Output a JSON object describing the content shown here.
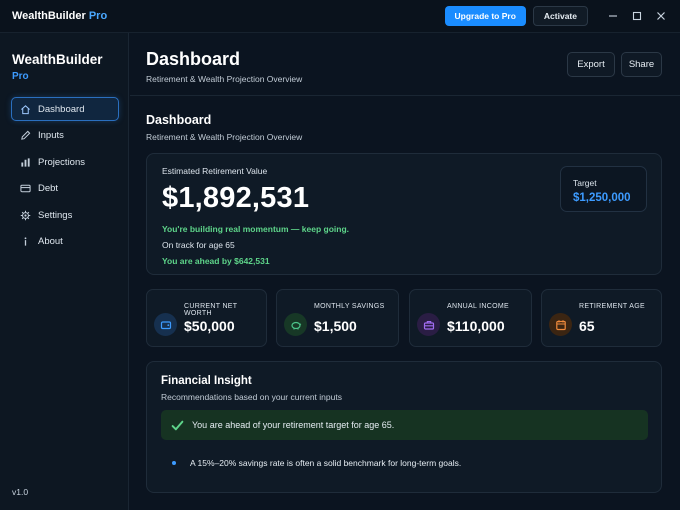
{
  "window": {
    "app_name": "WealthBuilder",
    "app_edition": "Pro",
    "upgrade_label": "Upgrade to Pro",
    "activate_label": "Activate"
  },
  "sidebar": {
    "brand": "WealthBuilder",
    "brand_sub": "Pro",
    "items": [
      {
        "label": "Dashboard",
        "icon": "home-icon",
        "active": true
      },
      {
        "label": "Inputs",
        "icon": "pencil-icon"
      },
      {
        "label": "Projections",
        "icon": "bar-chart-icon"
      },
      {
        "label": "Debt",
        "icon": "credit-card-icon"
      },
      {
        "label": "Settings",
        "icon": "gear-icon"
      },
      {
        "label": "About",
        "icon": "info-icon"
      }
    ],
    "version": "v1.0"
  },
  "header": {
    "title": "Dashboard",
    "subtitle": "Retirement & Wealth Projection Overview",
    "export_label": "Export",
    "share_label": "Share"
  },
  "section": {
    "title": "Dashboard",
    "subtitle": "Retirement & Wealth Projection Overview"
  },
  "hero": {
    "label": "Estimated Retirement Value",
    "value": "$1,892,531",
    "message": "You're building real momentum — keep going.",
    "track": "On track for age 65",
    "ahead": "You are ahead by $642,531",
    "target_label": "Target",
    "target_value": "$1,250,000"
  },
  "stats": [
    {
      "label": "CURRENT NET WORTH",
      "value": "$50,000",
      "icon": "wallet-icon",
      "color": "#3d9bff"
    },
    {
      "label": "MONTHLY SAVINGS",
      "value": "$1,500",
      "icon": "piggy-bank-icon",
      "color": "#4cc38a"
    },
    {
      "label": "ANNUAL INCOME",
      "value": "$110,000",
      "icon": "briefcase-icon",
      "color": "#a06cf0"
    },
    {
      "label": "RETIREMENT AGE",
      "value": "65",
      "icon": "calendar-icon",
      "color": "#f08a3c"
    }
  ],
  "insight": {
    "title": "Financial Insight",
    "subtitle": "Recommendations based on your current inputs",
    "success": "You are ahead of your retirement target for age 65.",
    "tip": "A 15%–20% savings rate is often a solid benchmark for long-term goals."
  },
  "colors": {
    "accent": "#1a8cff",
    "positive": "#5ed58a",
    "background": "#0b1420"
  }
}
